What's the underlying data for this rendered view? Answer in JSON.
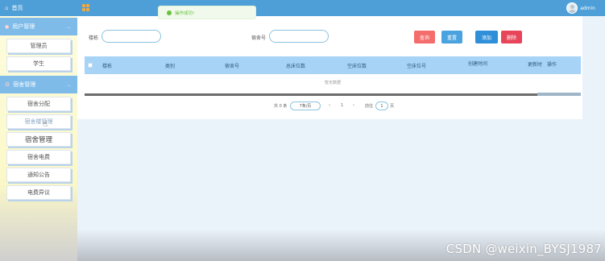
{
  "sidebar": {
    "home": {
      "label": "首页",
      "icon": "home-icon"
    },
    "groups": [
      {
        "label": "用户管理",
        "icon": "user-icon"
      },
      {
        "label": "宿舍管理",
        "icon": "gear-icon"
      }
    ],
    "user_items": [
      "管理员",
      "学生"
    ],
    "dorm_items": [
      "宿舍分配",
      "宿舍楼管理",
      "宿舍管理",
      "宿舍电费",
      "通知公告",
      "电费异议"
    ]
  },
  "topbar": {
    "toast": "操作成功!",
    "username": "admin",
    "accent_color": "#4e9fd8"
  },
  "search": {
    "building_label": "楼栋",
    "room_label": "宿舍号",
    "building_value": "",
    "room_value": ""
  },
  "buttons": {
    "query": "查询",
    "reset": "重置",
    "add": "添加",
    "delete": "删除"
  },
  "table": {
    "columns": [
      "楼栋",
      "类别",
      "宿舍号",
      "总床位数",
      "空床位数",
      "空床位号",
      "创建时间",
      "更新时",
      "操作"
    ],
    "empty_text": "暂无数据"
  },
  "pagination": {
    "total": "共 0 条",
    "page_size": "7条/页",
    "prev": "‹",
    "current": "1",
    "next": "›",
    "goto_label": "前往",
    "goto_value": "1",
    "page_unit": "页"
  },
  "watermark": "CSDN @weixin_BYSJ1987"
}
